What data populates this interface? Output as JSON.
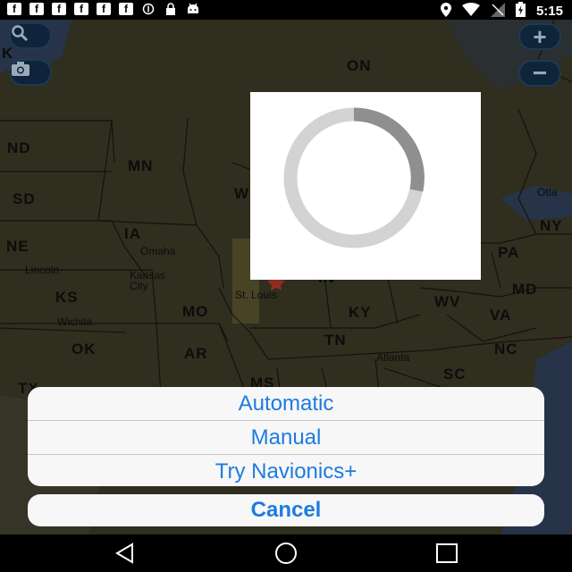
{
  "status_bar": {
    "left_icons": [
      "f",
      "f",
      "f",
      "f",
      "f",
      "f",
      "vpn-key-icon",
      "lock-icon",
      "android-icon"
    ],
    "right_icons": [
      "location-pin-icon",
      "wifi-icon",
      "no-signal-icon",
      "battery-charging-icon"
    ],
    "time": "5:15"
  },
  "map": {
    "states": [
      "ON",
      "ND",
      "MN",
      "SD",
      "NE",
      "IA",
      "KS",
      "MO",
      "OK",
      "AR",
      "TN",
      "KY",
      "WV",
      "VA",
      "NC",
      "SC",
      "PA",
      "MD",
      "NY",
      "MS",
      "TX",
      "W",
      "IN",
      "K"
    ],
    "cities": [
      "Omaha",
      "Lincoln",
      "Kansas City",
      "Wichita",
      "St. Louis",
      "Atlanta",
      "Otta"
    ],
    "buttons": {
      "search": "search-icon",
      "camera": "camera-icon",
      "zoom_in": "+",
      "zoom_out": "−"
    }
  },
  "action_sheet": {
    "options": [
      "Automatic",
      "Manual",
      "Try Navionics+"
    ],
    "cancel": "Cancel"
  },
  "nav": {
    "back": "back-icon",
    "home": "home-icon",
    "recents": "recents-icon"
  }
}
